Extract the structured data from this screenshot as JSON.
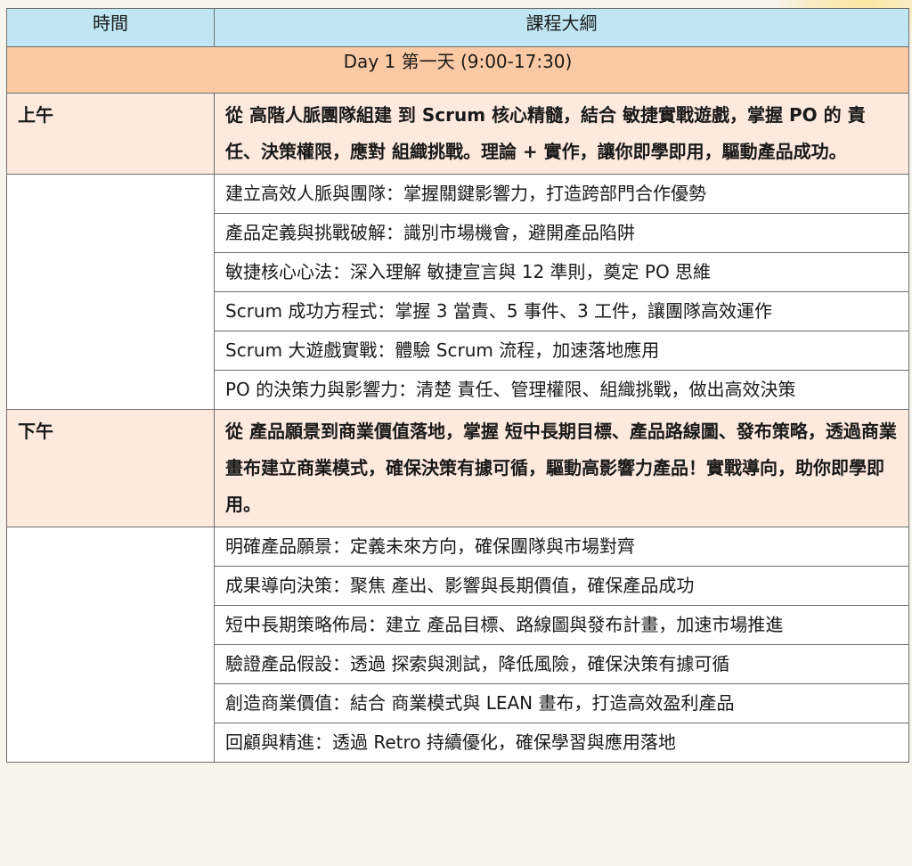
{
  "header": {
    "time_col": "時間",
    "outline_col": "課程大綱"
  },
  "day": {
    "title": "Day 1 第一天 (9:00-17:30)"
  },
  "sessions": [
    {
      "time": "上午",
      "summary": "從 高階人脈團隊組建 到 Scrum 核心精髓，結合 敏捷實戰遊戲，掌握 PO 的 責任、決策權限，應對 組織挑戰。理論 + 實作，讓你即學即用，驅動產品成功。",
      "items": [
        "建立高效人脈與團隊：掌握關鍵影響力，打造跨部門合作優勢",
        "產品定義與挑戰破解：識別市場機會，避開產品陷阱",
        "敏捷核心心法：深入理解 敏捷宣言與 12 準則，奠定 PO 思維",
        "Scrum 成功方程式：掌握 3 當責、5 事件、3 工件，讓團隊高效運作",
        "Scrum 大遊戲實戰：體驗 Scrum 流程，加速落地應用",
        "PO 的決策力與影響力：清楚 責任、管理權限、組織挑戰，做出高效決策"
      ]
    },
    {
      "time": "下午",
      "summary": "從 產品願景到商業價值落地，掌握 短中長期目標、產品路線圖、發布策略，透過商業畫布建立商業模式，確保決策有據可循，驅動高影響力產品！實戰導向，助你即學即用。",
      "items": [
        "明確產品願景：定義未來方向，確保團隊與市場對齊",
        "成果導向決策：聚焦 產出、影響與長期價值，確保產品成功",
        "短中長期策略佈局：建立 產品目標、路線圖與發布計畫，加速市場推進",
        "驗證產品假設：透過 探索與測試，降低風險，確保決策有據可循",
        "創造商業價值：結合 商業模式與 LEAN 畫布，打造高效盈利產品",
        "回顧與精進：透過 Retro 持續優化，確保學習與應用落地"
      ]
    }
  ]
}
